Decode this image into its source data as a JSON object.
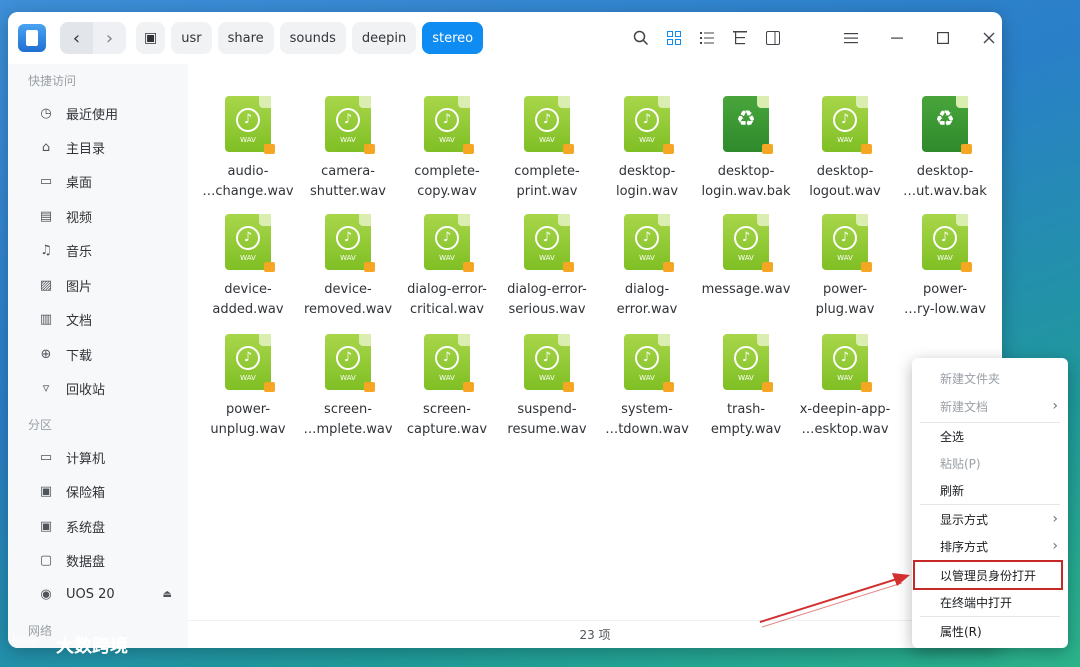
{
  "titlebar": {
    "nav": {
      "back": "‹",
      "forward": "›"
    },
    "breadcrumb": [
      {
        "label": "▣",
        "kind": "root-icon"
      },
      {
        "label": "usr"
      },
      {
        "label": "share"
      },
      {
        "label": "sounds"
      },
      {
        "label": "deepin"
      },
      {
        "label": "stereo",
        "active": true
      }
    ],
    "icons": [
      "search-icon",
      "icon-view-icon",
      "list-view-icon",
      "tree-view-icon",
      "details-panel-icon"
    ],
    "window_controls": [
      "menu-icon",
      "minimize-icon",
      "maximize-icon",
      "close-icon"
    ]
  },
  "sidebar": {
    "quick_access_title": "快捷访问",
    "quick_access": [
      {
        "label": "最近使用",
        "icon": "clock-icon",
        "glyph": "◷"
      },
      {
        "label": "主目录",
        "icon": "home-icon",
        "glyph": "⌂"
      },
      {
        "label": "桌面",
        "icon": "desktop-icon",
        "glyph": "▭"
      },
      {
        "label": "视频",
        "icon": "video-icon",
        "glyph": "▤"
      },
      {
        "label": "音乐",
        "icon": "music-icon",
        "glyph": "♫"
      },
      {
        "label": "图片",
        "icon": "picture-icon",
        "glyph": "▨"
      },
      {
        "label": "文档",
        "icon": "document-icon",
        "glyph": "▥"
      },
      {
        "label": "下载",
        "icon": "download-icon",
        "glyph": "⊕"
      },
      {
        "label": "回收站",
        "icon": "trash-icon",
        "glyph": "▿"
      }
    ],
    "partitions_title": "分区",
    "partitions": [
      {
        "label": "计算机",
        "icon": "computer-icon",
        "glyph": "▭"
      },
      {
        "label": "保险箱",
        "icon": "vault-icon",
        "glyph": "▣"
      },
      {
        "label": "系统盘",
        "icon": "system-disk-icon",
        "glyph": "▣"
      },
      {
        "label": "数据盘",
        "icon": "data-disk-icon",
        "glyph": "▢"
      },
      {
        "label": "UOS 20",
        "icon": "disc-icon",
        "glyph": "◉",
        "eject": "⏏"
      }
    ],
    "network_title": "网络"
  },
  "files": [
    {
      "line1": "audio-",
      "line2": "…change.wav",
      "kind": "wav"
    },
    {
      "line1": "camera-",
      "line2": "shutter.wav",
      "kind": "wav"
    },
    {
      "line1": "complete-",
      "line2": "copy.wav",
      "kind": "wav"
    },
    {
      "line1": "complete-",
      "line2": "print.wav",
      "kind": "wav"
    },
    {
      "line1": "desktop-",
      "line2": "login.wav",
      "kind": "wav"
    },
    {
      "line1": "desktop-",
      "line2": "login.wav.bak",
      "kind": "bak"
    },
    {
      "line1": "desktop-",
      "line2": "logout.wav",
      "kind": "wav"
    },
    {
      "line1": "desktop-",
      "line2": "…ut.wav.bak",
      "kind": "bak"
    },
    {
      "line1": "device-",
      "line2": "added.wav",
      "kind": "wav"
    },
    {
      "line1": "device-",
      "line2": "removed.wav",
      "kind": "wav"
    },
    {
      "line1": "dialog-error-",
      "line2": "critical.wav",
      "kind": "wav"
    },
    {
      "line1": "dialog-error-",
      "line2": "serious.wav",
      "kind": "wav"
    },
    {
      "line1": "dialog-",
      "line2": "error.wav",
      "kind": "wav"
    },
    {
      "line1": "message.wav",
      "line2": "",
      "kind": "wav"
    },
    {
      "line1": "power-",
      "line2": "plug.wav",
      "kind": "wav"
    },
    {
      "line1": "power-",
      "line2": "…ry-low.wav",
      "kind": "wav"
    },
    {
      "line1": "power-",
      "line2": "unplug.wav",
      "kind": "wav"
    },
    {
      "line1": "screen-",
      "line2": "…mplete.wav",
      "kind": "wav"
    },
    {
      "line1": "screen-",
      "line2": "capture.wav",
      "kind": "wav"
    },
    {
      "line1": "suspend-",
      "line2": "resume.wav",
      "kind": "wav"
    },
    {
      "line1": "system-",
      "line2": "…tdown.wav",
      "kind": "wav"
    },
    {
      "line1": "trash-",
      "line2": "empty.wav",
      "kind": "wav"
    },
    {
      "line1": "x-deepin-app-",
      "line2": "…esktop.wav",
      "kind": "wav"
    }
  ],
  "file_icon": {
    "wav_label": "WAV",
    "note_glyph": "♪",
    "recycle_glyph": "♻",
    "wav_color": "#8cc63f",
    "bak_color": "#3a9a35",
    "lock_color": "#f5a623"
  },
  "status": {
    "count": "23 项"
  },
  "context_menu": {
    "items": [
      {
        "label": "新建文件夹",
        "disabled": true
      },
      {
        "label": "新建文档",
        "disabled": true,
        "submenu": true
      },
      {
        "label": "全选"
      },
      {
        "label": "粘贴(P)",
        "disabled": true
      },
      {
        "label": "刷新"
      },
      {
        "label": "显示方式",
        "submenu": true
      },
      {
        "label": "排序方式",
        "submenu": true
      },
      {
        "label": "以管理员身份打开",
        "highlighted": true
      },
      {
        "label": "在终端中打开"
      },
      {
        "label": "属性(R)"
      }
    ],
    "arrow_glyph": "›",
    "highlight_color": "#c62828"
  },
  "watermark": {
    "logo": "i◎◎",
    "text": "大数跨境"
  },
  "colors": {
    "accent": "#0f8cf2"
  }
}
